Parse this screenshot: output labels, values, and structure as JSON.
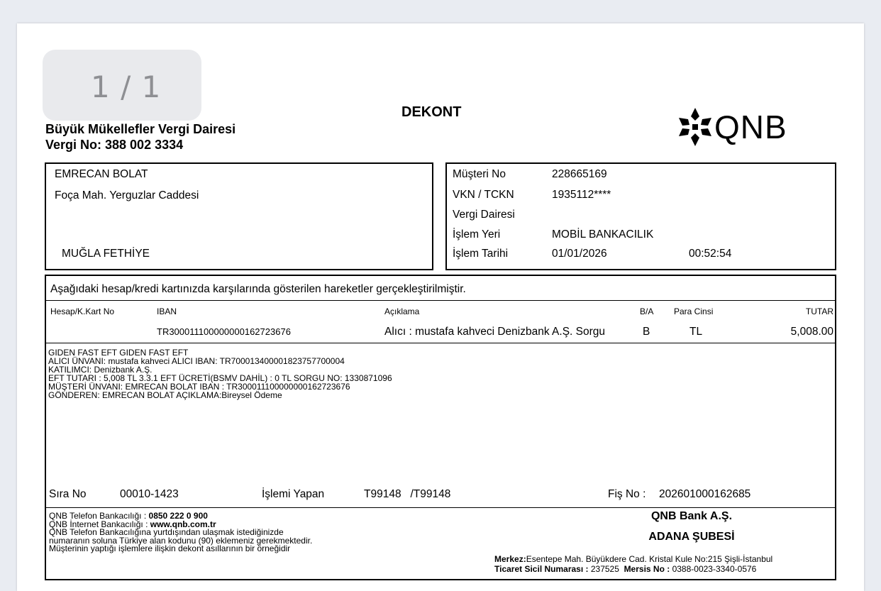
{
  "viewer": {
    "page_indicator": "1 / 1"
  },
  "header": {
    "tax_office": "Büyük Mükellefler Vergi Dairesi",
    "tax_no": "Vergi No: 388 002 3334",
    "title": "DEKONT",
    "logo_text": "QNB"
  },
  "customer": {
    "name": "EMRECAN BOLAT",
    "address": "Foça Mah. Yerguzlar Caddesi",
    "city": "MUĞLA FETHİYE"
  },
  "info": {
    "customer_no_label": "Müşteri No",
    "customer_no": "228665169",
    "vkn_label": "VKN / TCKN",
    "vkn": "1935112****",
    "tax_office_label": "Vergi Dairesi",
    "location_label": "İşlem Yeri",
    "location": "MOBİL BANKACILIK",
    "date_label": "İşlem Tarihi",
    "date": "01/01/2026",
    "time": "00:52:54"
  },
  "transaction": {
    "intro": "Aşağıdaki hesap/kredi kartınızda karşılarında gösterilen hareketler gerçekleştirilmiştir.",
    "headers": {
      "account": "Hesap/K.Kart No",
      "iban": "IBAN",
      "description": "Açıklama",
      "ba": "B/A",
      "currency": "Para Cinsi",
      "amount": "TUTAR"
    },
    "row": {
      "iban": "TR300011100000000162723676",
      "description": "Alıcı : mustafa kahveci Denizbank A.Ş. Sorgu",
      "ba": "B",
      "currency": "TL",
      "amount": "5,008.00"
    },
    "details": [
      "GIDEN FAST EFT GIDEN FAST EFT",
      "ALICI ÜNVANI: mustafa kahveci   ALICI IBAN: TR700013400001823757700004",
      "KATILIMCI: Denizbank A.Ş.",
      "EFT TUTARI : 5,008 TL  3.3.1 EFT ÜCRETİ(BSMV DAHİL) : 0 TL SORGU NO: 1330871096",
      "MÜŞTERİ ÜNVANI: EMRECAN BOLAT  IBAN : TR300011100000000162723676",
      "GÖNDEREN: EMRECAN BOLAT   AÇIKLAMA:Bireysel Ödeme"
    ],
    "seq_label": "Sıra No",
    "seq_no": "00010-1423",
    "operator_label": "İşlemi Yapan",
    "operator": "T99148   /T99148",
    "receipt_label": "Fiş No :",
    "receipt_no": "202601000162685"
  },
  "footer": {
    "phone_label": "QNB Telefon Bankacılığı : ",
    "phone": "0850 222 0 900",
    "web_label": "QNB İnternet Bankacılığı : ",
    "web": "www.qnb.com.tr",
    "note1": "QNB Telefon Bankacılığına yurtdışından ulaşmak istediğinizde",
    "note2": "numaranın soluna Türkiye alan kodunu (90) eklemeniz gerekmektedir.",
    "note3": "Müşterinin yaptığı işlemlere ilişkin dekont asıllarının bir örneğidir",
    "bank_name": "QNB Bank A.Ş.",
    "branch": "ADANA ŞUBESİ",
    "hq_label": "Merkez:",
    "hq": "Esentepe Mah. Büyükdere Cad. Kristal Kule No:215 Şişli-İstanbul",
    "registry_label": "Ticaret Sicil Numarası : ",
    "registry": "237525",
    "mersis_label": "Mersis No : ",
    "mersis": "0388-0023-3340-0576"
  }
}
